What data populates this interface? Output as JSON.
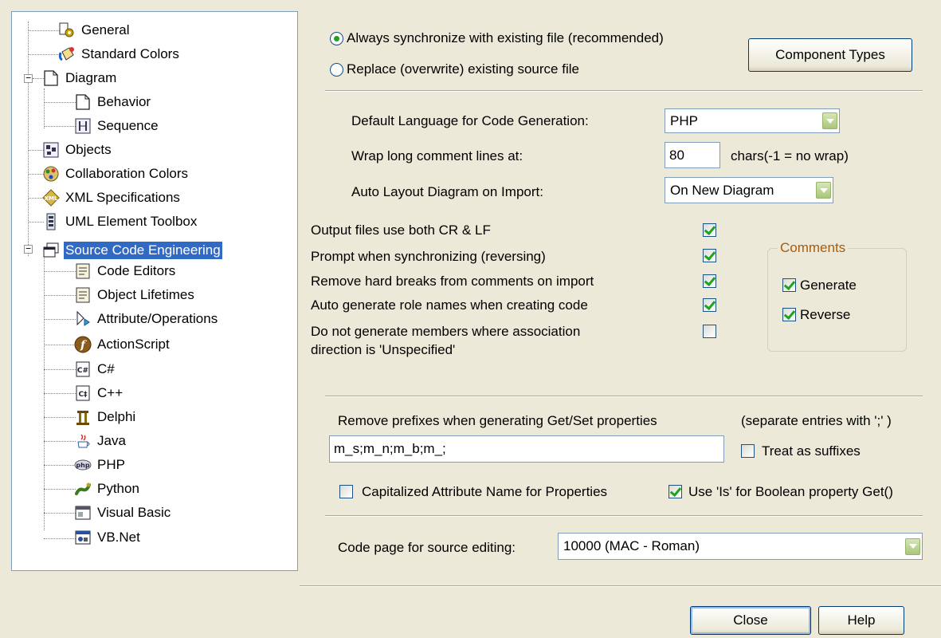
{
  "tree": {
    "items": [
      {
        "label": "General",
        "icon": "general-icon"
      },
      {
        "label": "Standard Colors",
        "icon": "paint-bucket-icon"
      },
      {
        "label": "Diagram",
        "icon": "diagram-icon",
        "expander": "minus"
      },
      {
        "label": "Behavior",
        "icon": "document-icon"
      },
      {
        "label": "Sequence",
        "icon": "sequence-icon"
      },
      {
        "label": "Objects",
        "icon": "objects-icon"
      },
      {
        "label": "Collaboration Colors",
        "icon": "collaboration-icon"
      },
      {
        "label": "XML Specifications",
        "icon": "xml-icon"
      },
      {
        "label": "UML Element Toolbox",
        "icon": "toolbox-icon"
      },
      {
        "label": "Source Code Engineering",
        "icon": "windows-icon",
        "expander": "minus",
        "selected": true
      },
      {
        "label": "Code Editors",
        "icon": "code-page-icon"
      },
      {
        "label": "Object Lifetimes",
        "icon": "code-page-icon"
      },
      {
        "label": "Attribute/Operations",
        "icon": "attribute-icon"
      },
      {
        "label": "ActionScript",
        "icon": "actionscript-icon"
      },
      {
        "label": "C#",
        "icon": "csharp-icon"
      },
      {
        "label": "C++",
        "icon": "cpp-icon"
      },
      {
        "label": "Delphi",
        "icon": "delphi-icon"
      },
      {
        "label": "Java",
        "icon": "java-icon"
      },
      {
        "label": "PHP",
        "icon": "php-icon"
      },
      {
        "label": "Python",
        "icon": "python-icon"
      },
      {
        "label": "Visual Basic",
        "icon": "visual-basic-icon"
      },
      {
        "label": "VB.Net",
        "icon": "vbnet-icon"
      }
    ],
    "selected_color": "#316AC5"
  },
  "sync": {
    "options": [
      {
        "label": "Always synchronize with existing file (recommended)",
        "selected": true
      },
      {
        "label": "Replace (overwrite) existing source file",
        "selected": false
      }
    ],
    "component_types_label": "Component Types"
  },
  "codegen": {
    "language_label": "Default Language for Code Generation:",
    "language_value": "PHP",
    "wrap_label": "Wrap long comment lines at:",
    "wrap_value": "80",
    "wrap_hint": "chars(-1 = no wrap)",
    "layout_label": "Auto Layout Diagram on Import:",
    "layout_value": "On New Diagram"
  },
  "options": {
    "items": [
      {
        "label": "Output files use both CR & LF",
        "checked": true
      },
      {
        "label": "Prompt when synchronizing (reversing)",
        "checked": true
      },
      {
        "label": "Remove hard breaks from  comments on import",
        "checked": true
      },
      {
        "label": "Auto generate role names when creating code",
        "checked": true
      },
      {
        "label": "Do not generate members where association",
        "label2": "direction is 'Unspecified'",
        "checked": false
      }
    ]
  },
  "comments": {
    "title": "Comments",
    "generate_label": "Generate",
    "generate_checked": true,
    "reverse_label": "Reverse",
    "reverse_checked": true
  },
  "prefixes": {
    "label": "Remove prefixes when generating Get/Set properties",
    "hint": "(separate entries with ';' )",
    "value": "m_s;m_n;m_b;m_;",
    "suffix_label": "Treat as suffixes",
    "suffix_checked": false,
    "capitalized_label": "Capitalized Attribute Name for Properties",
    "capitalized_checked": false,
    "use_is_label": "Use 'Is' for Boolean property Get()",
    "use_is_checked": true
  },
  "codepage": {
    "label": "Code page for source editing:",
    "value": "10000 (MAC - Roman)"
  },
  "footer": {
    "close_label": "Close",
    "help_label": "Help"
  },
  "colors": {
    "dialog_bg": "#ECE9D8",
    "check_green": "#21A121",
    "group_title": "#A65C0E",
    "border_blue": "#7F9DB9"
  }
}
